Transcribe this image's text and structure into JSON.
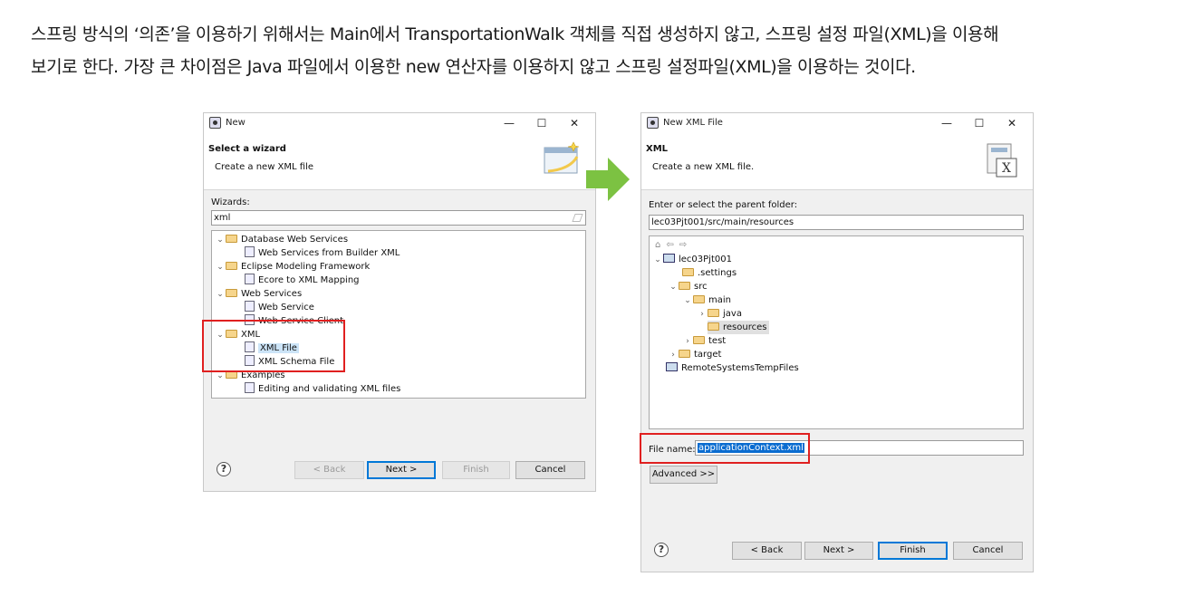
{
  "paragraph": {
    "line1": "스프링 방식의 ‘의존’을 이용하기 위해서는 Main에서 TransportationWalk 객체를 직접 생성하지 않고, 스프링 설정 파일(XML)을 이용해",
    "line2": "보기로 한다. 가장 큰 차이점은 Java 파일에서 이용한 new 연산자를 이용하지 않고 스프링 설정파일(XML)을 이용하는 것이다."
  },
  "colors": {
    "arrow": "#7cc242",
    "highlight_box": "#e02020",
    "selection": "#0a6cd0"
  },
  "window_controls": {
    "minimize": "—",
    "maximize": "☐",
    "close": "✕"
  },
  "dialog1": {
    "title": "New",
    "header_title": "Select a wizard",
    "header_desc": "Create a new XML file",
    "wizards_label": "Wizards:",
    "filter_value": "xml",
    "tree": [
      {
        "label": "Database Web Services",
        "type": "folder",
        "expanded": true
      },
      {
        "label": "Web Services from Builder XML",
        "type": "item"
      },
      {
        "label": "Eclipse Modeling Framework",
        "type": "folder",
        "expanded": true
      },
      {
        "label": "Ecore to XML Mapping",
        "type": "item"
      },
      {
        "label": "Web Services",
        "type": "folder",
        "expanded": true
      },
      {
        "label": "Web Service",
        "type": "item"
      },
      {
        "label": "Web Service Client",
        "type": "item"
      },
      {
        "label": "XML",
        "type": "folder",
        "expanded": true
      },
      {
        "label": "XML File",
        "type": "item",
        "selected": true
      },
      {
        "label": "XML Schema File",
        "type": "item"
      },
      {
        "label": "Examples",
        "type": "folder",
        "expanded": true
      },
      {
        "label": "Editing and validating XML files",
        "type": "item"
      }
    ],
    "buttons": {
      "help": "?",
      "back": "< Back",
      "next": "Next >",
      "finish": "Finish",
      "cancel": "Cancel"
    }
  },
  "dialog2": {
    "title": "New XML File",
    "header_title": "XML",
    "header_desc": "Create a new XML file.",
    "parent_label": "Enter or select the parent folder:",
    "parent_value": "lec03Pjt001/src/main/resources",
    "nav_icons": [
      "home-icon",
      "back-arrow-icon",
      "forward-arrow-icon"
    ],
    "tree": [
      {
        "label": "lec03Pjt001",
        "type": "project",
        "expanded": true
      },
      {
        "label": ".settings",
        "type": "folder"
      },
      {
        "label": "src",
        "type": "folder",
        "expanded": true
      },
      {
        "label": "main",
        "type": "folder",
        "expanded": true
      },
      {
        "label": "java",
        "type": "folder",
        "expanded": false
      },
      {
        "label": "resources",
        "type": "folder",
        "selected": true
      },
      {
        "label": "test",
        "type": "folder",
        "expanded": false
      },
      {
        "label": "target",
        "type": "folder",
        "expanded": false
      },
      {
        "label": "RemoteSystemsTempFiles",
        "type": "project"
      }
    ],
    "file_name_label": "File name:",
    "file_name_value": "applicationContext.xml",
    "advanced": "Advanced >>",
    "buttons": {
      "help": "?",
      "back": "< Back",
      "next": "Next >",
      "finish": "Finish",
      "cancel": "Cancel"
    }
  }
}
